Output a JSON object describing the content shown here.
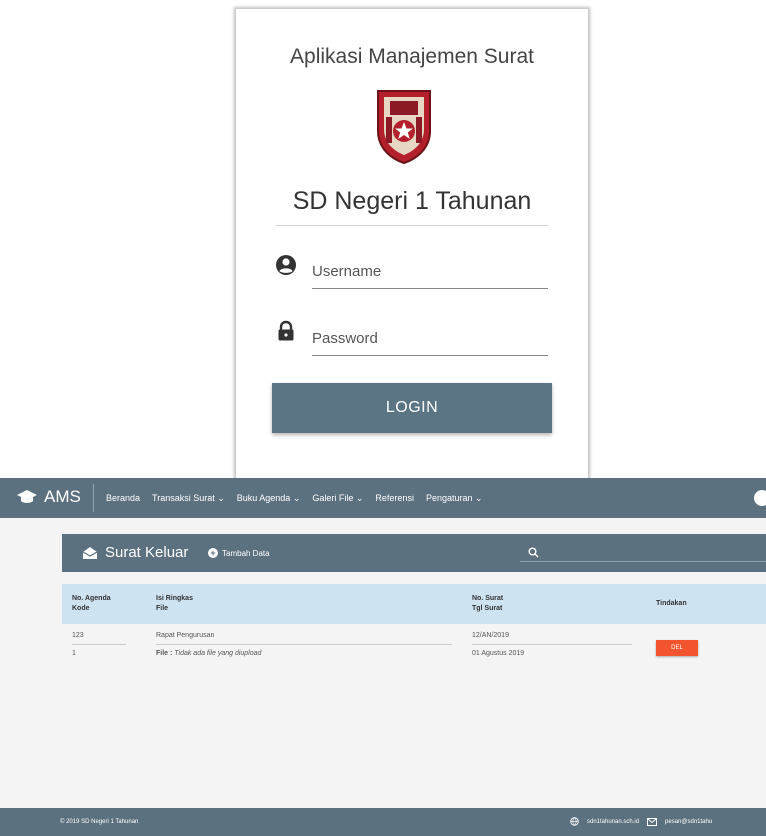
{
  "login": {
    "title": "Aplikasi Manajemen Surat",
    "school": "SD Negeri 1 Tahunan",
    "username_placeholder": "Username",
    "password_placeholder": "Password",
    "login_label": "LOGIN"
  },
  "navbar": {
    "brand": "AMS",
    "items": [
      "Beranda",
      "Transaksi Surat ⌄",
      "Buku Agenda ⌄",
      "Galeri File ⌄",
      "Referensi",
      "Pengaturan ⌄"
    ]
  },
  "toolbar": {
    "title": "Surat Keluar",
    "add_label": "Tambah Data"
  },
  "table": {
    "headers": {
      "col1_line1": "No. Agenda",
      "col1_line2": "Kode",
      "col2_line1": "Isi Ringkas",
      "col2_line2": "File",
      "col3_line1": "No. Surat",
      "col3_line2": "Tgl Surat",
      "col4": "Tindakan"
    },
    "rows": [
      {
        "agenda": "123",
        "kode": "1",
        "isi": "Rapat Pengurusan",
        "file_label": "File :",
        "file_value": "Tidak ada file yang diupload",
        "no_surat": "12/AN/2019",
        "tgl_surat": "01 Agustus 2019",
        "action": "DEL"
      }
    ]
  },
  "footer": {
    "left": "© 2019 SD Negeri 1 Tahunan",
    "website": "sdn1tahunan.sch.id",
    "email": "pesan@sdn1tahu"
  },
  "colors": {
    "primary": "#5b7180",
    "header_bg": "#cde3f2",
    "danger": "#f2542d"
  }
}
